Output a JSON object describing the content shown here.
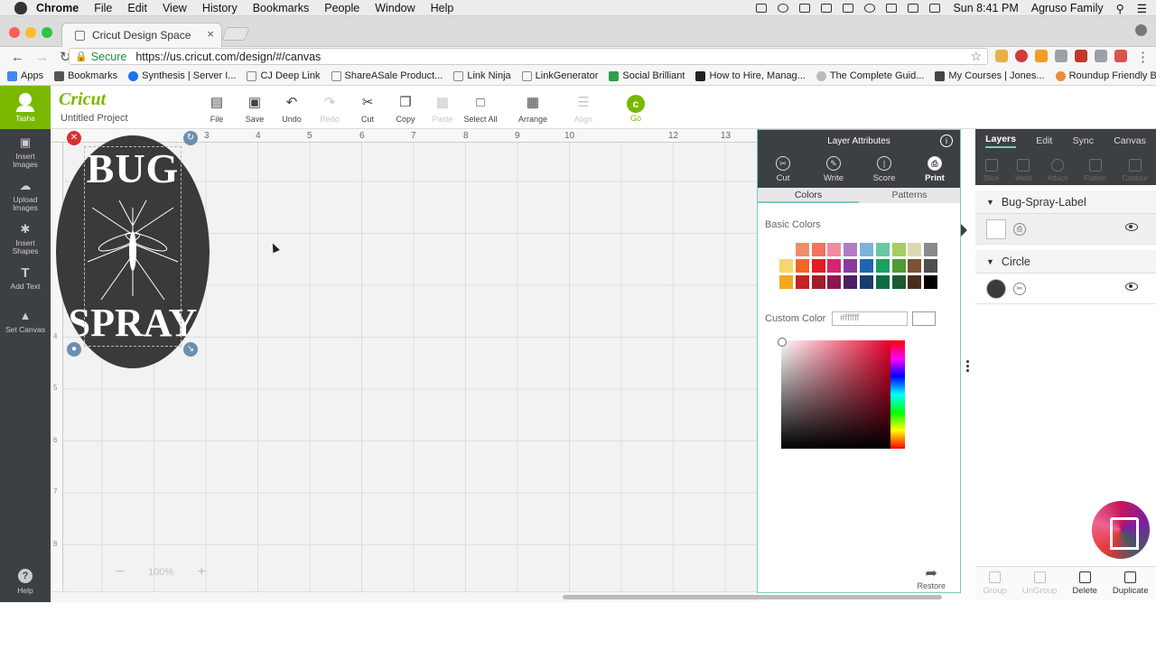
{
  "mac_menu": {
    "app": "Chrome",
    "items": [
      "File",
      "Edit",
      "View",
      "History",
      "Bookmarks",
      "People",
      "Window",
      "Help"
    ],
    "clock": "Sun 8:41 PM",
    "user": "Agruso Family"
  },
  "browser": {
    "tab_title": "Cricut Design Space",
    "secure_label": "Secure",
    "url": "https://us.cricut.com/design/#/canvas",
    "bookmarks": [
      "Apps",
      "Bookmarks",
      "Synthesis | Server I...",
      "CJ Deep Link",
      "ShareASale Product...",
      "Link Ninja",
      "LinkGenerator",
      "Social Brilliant",
      "How to Hire, Manag...",
      "The Complete Guid...",
      "My Courses | Jones...",
      "Roundup Friendly B..."
    ]
  },
  "sidebar": {
    "user_name": "Tasha",
    "items": [
      {
        "label": "Insert Images"
      },
      {
        "label": "Upload Images"
      },
      {
        "label": "Insert Shapes"
      },
      {
        "label": "Add Text"
      },
      {
        "label": "Set Canvas"
      }
    ],
    "help": "Help"
  },
  "header": {
    "logo": "Cricut",
    "project": "Untitled Project",
    "toolbar": [
      "File",
      "Save",
      "Undo",
      "Redo",
      "Cut",
      "Copy",
      "Paste",
      "Select All",
      "Arrange",
      "Align"
    ],
    "go": "Go"
  },
  "canvas": {
    "ruler_h": [
      "3",
      "4",
      "5",
      "6",
      "7",
      "8",
      "9",
      "10",
      "12",
      "13"
    ],
    "ruler_v": [
      "4",
      "5",
      "6",
      "7",
      "8"
    ],
    "label_top": "BUG",
    "label_bottom": "SPRAY",
    "zoom": "100%",
    "zoom_out": "−",
    "zoom_in": "+"
  },
  "layer_attributes": {
    "title": "Layer Attributes",
    "info": "i",
    "ops": [
      {
        "label": "Cut",
        "active": false
      },
      {
        "label": "Write",
        "active": false
      },
      {
        "label": "Score",
        "active": false
      },
      {
        "label": "Print",
        "active": true
      }
    ],
    "tabs": [
      "Colors",
      "Patterns"
    ],
    "basic_colors_label": "Basic Colors",
    "swatches": [
      [
        "#ffffff",
        "#f08d6b",
        "#f07361",
        "#f28ba0",
        "#b07cc4",
        "#7ab5d9",
        "#69c7a6",
        "#a4cf5d",
        "#ddd7b0",
        "#8a8a8a"
      ],
      [
        "#f5d76e",
        "#f26522",
        "#e31b23",
        "#d6246e",
        "#8a3a9c",
        "#1f66b1",
        "#15a35e",
        "#4f9b35",
        "#7a5234",
        "#4d4d4d"
      ],
      [
        "#f5a81c",
        "#c52126",
        "#a31c2b",
        "#8e1650",
        "#4d1f63",
        "#1d3a70",
        "#0f6b46",
        "#1c5a32",
        "#4b2e1a",
        "#000000"
      ]
    ],
    "custom_color_label": "Custom Color",
    "hex_value": "#ffffff",
    "restore": "Restore"
  },
  "layers_panel": {
    "tabs": [
      "Layers",
      "Edit",
      "Sync",
      "Canvas"
    ],
    "tools": [
      "Slice",
      "Weld",
      "Attach",
      "Flatten",
      "Contour"
    ],
    "groups": [
      {
        "name": "Bug-Spray-Label",
        "swatch": "#ffffff"
      },
      {
        "name": "Circle",
        "swatch": "#3a3a3a"
      }
    ],
    "bottom": [
      "Group",
      "UnGroup",
      "Delete",
      "Duplicate"
    ]
  },
  "colors": {
    "accent": "#7ab800",
    "panel_dark": "#3c4043",
    "teal": "#7cc9bf"
  }
}
